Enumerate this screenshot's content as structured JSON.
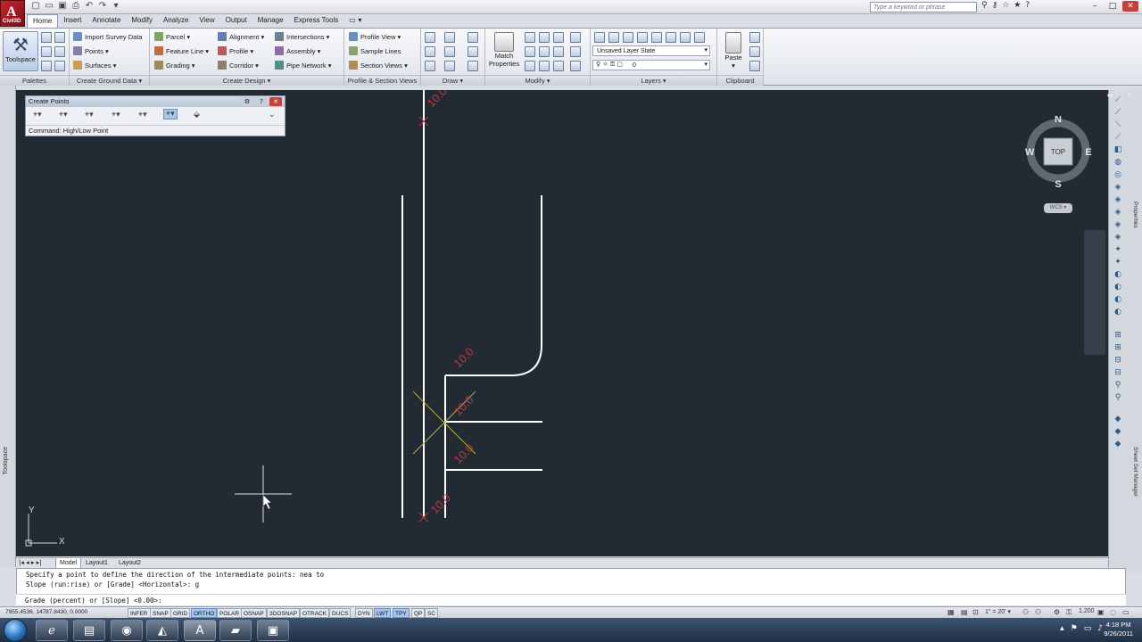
{
  "app": {
    "logo_letter": "A",
    "logo_sub": "Civil3D"
  },
  "search": {
    "placeholder": "Type a keyword or phrase"
  },
  "ribbon_tabs": [
    "Home",
    "Insert",
    "Annotate",
    "Modify",
    "Analyze",
    "View",
    "Output",
    "Manage",
    "Express Tools"
  ],
  "ribbon": {
    "palettes": {
      "toolspace_label": "Toolspace",
      "panel_label": "Palettes"
    },
    "create_ground_data": {
      "items": [
        "Import Survey Data",
        "Points",
        "Surfaces"
      ],
      "panel_label": "Create Ground Data"
    },
    "create_design": {
      "col1": [
        "Parcel",
        "Feature Line",
        "Grading"
      ],
      "col2": [
        "Alignment",
        "Profile",
        "Corridor"
      ],
      "col3": [
        "Intersections",
        "Assembly",
        "Pipe Network"
      ],
      "panel_label": "Create Design"
    },
    "profile_section_views": {
      "items": [
        "Profile View",
        "Sample Lines",
        "Section Views"
      ],
      "panel_label": "Profile & Section Views"
    },
    "draw": {
      "panel_label": "Draw"
    },
    "modify": {
      "match_properties_label": "Match\nProperties",
      "panel_label": "Modify"
    },
    "layers": {
      "layer_state": "Unsaved Layer State",
      "current_layer": "0",
      "panel_label": "Layers"
    },
    "clipboard": {
      "paste_label": "Paste",
      "panel_label": "Clipboard"
    }
  },
  "create_points": {
    "title": "Create Points",
    "command": "Command: High/Low Point"
  },
  "viewcube": {
    "north": "N",
    "south": "S",
    "east": "E",
    "west": "W",
    "face": "TOP",
    "wcs": "WCS"
  },
  "drawing": {
    "labels": [
      "10.0",
      "10.0",
      "10.0",
      "10.0",
      "10.0"
    ],
    "ucs_x": "X",
    "ucs_y": "Y"
  },
  "layout_tabs": [
    "Model",
    "Layout1",
    "Layout2"
  ],
  "command_line": {
    "line1": "Specify a point to define the direction of the intermediate points: nea to",
    "line2": "Slope (run:rise) or [Grade] <Horizontal>: g",
    "prompt": "Grade (percent) or [Slope] <0.00>:"
  },
  "left_panel_label": "Toolspace",
  "right_panel_labels": [
    "Properties",
    "Sheet Set Manager"
  ],
  "statusbar": {
    "coords": "7955.4536, 14787.8430, 0.0000",
    "toggles": [
      {
        "label": "INFER",
        "on": false
      },
      {
        "label": "SNAP",
        "on": false
      },
      {
        "label": "GRID",
        "on": false
      },
      {
        "label": "ORTHO",
        "on": true
      },
      {
        "label": "POLAR",
        "on": false
      },
      {
        "label": "OSNAP",
        "on": false
      },
      {
        "label": "3DOSNAP",
        "on": false
      },
      {
        "label": "OTRACK",
        "on": false
      },
      {
        "label": "DUCS",
        "on": false
      },
      {
        "label": "DYN",
        "on": false
      },
      {
        "label": "LWT",
        "on": true
      },
      {
        "label": "TPY",
        "on": true
      },
      {
        "label": "QP",
        "on": false
      },
      {
        "label": "SC",
        "on": false
      }
    ],
    "scale": "1\" = 20'",
    "elevation_text": "1.200"
  },
  "taskbar": {
    "time": "4:18 PM",
    "date": "9/26/2011"
  },
  "colors": {
    "canvas_bg": "#222b34",
    "linework": "#ffffff",
    "label_red": "#c9323c",
    "label_yellow": "#b5b12e",
    "ortho_on": "#a8c6ec"
  }
}
